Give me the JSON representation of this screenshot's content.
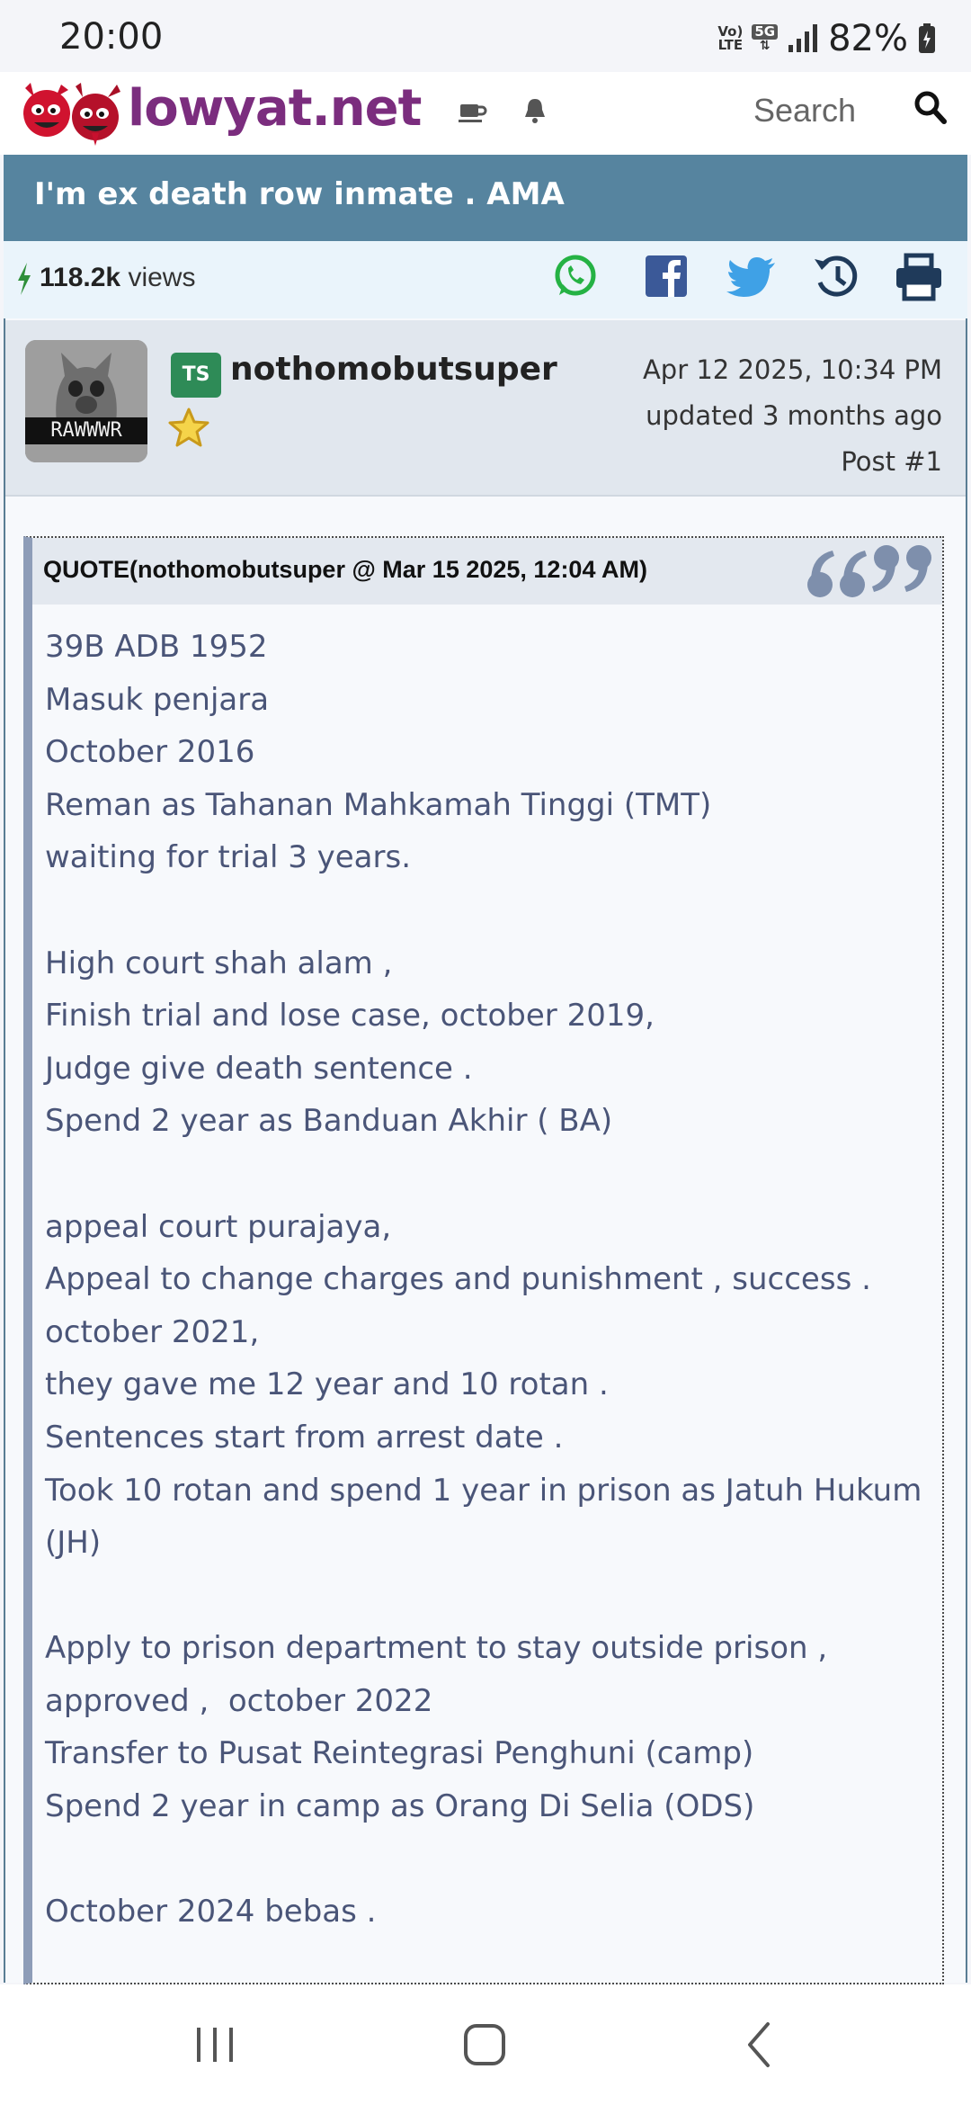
{
  "status_bar": {
    "time": "20:00",
    "volte_top": "Vo)",
    "volte_bottom": "LTE",
    "network": "5G",
    "battery": "82%"
  },
  "header": {
    "site_name": "lowyat.net",
    "search_label": "Search",
    "icons": [
      "coffee-icon",
      "bell-icon",
      "search-icon"
    ]
  },
  "topic": {
    "title": "I'm ex death row inmate . AMA",
    "views_count": "118.2k",
    "views_label": " views",
    "share_icons": [
      "whatsapp-icon",
      "facebook-icon",
      "twitter-icon",
      "history-icon",
      "print-icon"
    ]
  },
  "post": {
    "avatar_caption": "RAWWWR",
    "badge": "TS",
    "username": "nothomobutsuper",
    "date": "Apr 12 2025, 10:34 PM",
    "updated": "updated 3 months ago",
    "post_number": "Post #1"
  },
  "quote": {
    "header": "QUOTE(nothomobutsuper @ Mar 15 2025, 12:04 AM)",
    "lines": [
      "39B ADB 1952",
      "Masuk penjara",
      "October 2016",
      "Reman as Tahanan Mahkamah Tinggi (TMT)",
      "waiting for trial 3 years.",
      "",
      "High court shah alam ,",
      "Finish trial and lose case, october 2019,",
      "Judge give death sentence .",
      "Spend 2 year as Banduan Akhir ( BA)",
      "",
      "appeal court purajaya,",
      "Appeal to change charges and punishment , success .",
      "october 2021,",
      "they gave me 12 year and 10 rotan .",
      "Sentences start from arrest date .",
      "Took 10 rotan and spend 1 year in prison as Jatuh Hukum",
      "(JH)",
      "",
      "Apply to prison department to stay outside prison ,",
      "approved ,  october 2022",
      "Transfer to Pusat Reintegrasi Penghuni (camp)",
      "Spend 2 year in camp as Orang Di Selia (ODS)",
      "",
      "October 2024 bebas ."
    ]
  },
  "nav": [
    "recent-apps-button",
    "home-button",
    "back-button"
  ],
  "colors": {
    "brand": "#7b2d7e",
    "topic_bar": "#56849f",
    "ts_badge": "#2e8b57",
    "quote_text": "#4a5578"
  }
}
